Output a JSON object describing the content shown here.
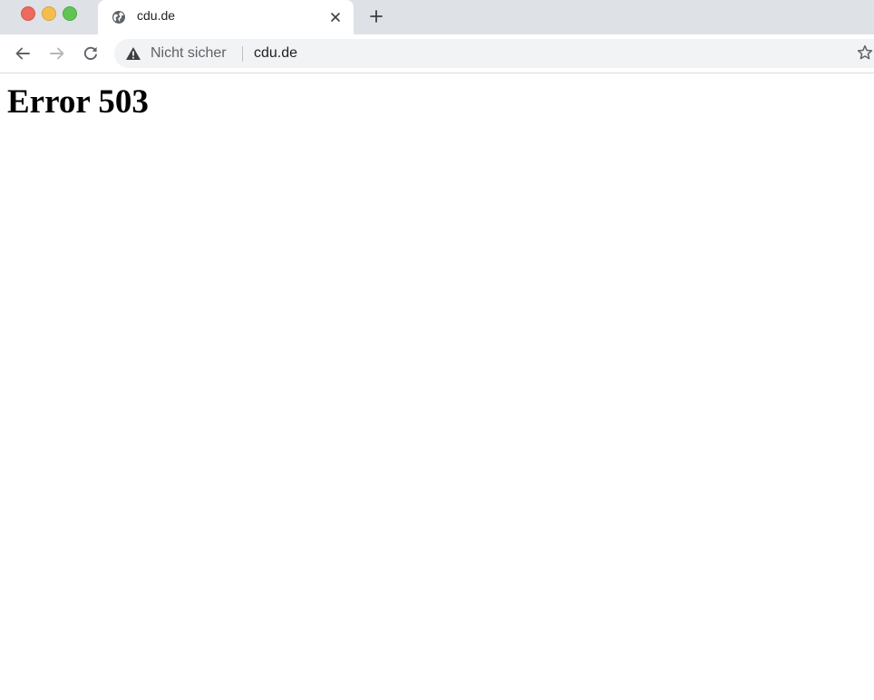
{
  "window": {
    "traffic_lights": [
      "close",
      "minimize",
      "maximize"
    ]
  },
  "tab": {
    "title": "cdu.de",
    "favicon": "globe-icon",
    "close_icon": "close-icon"
  },
  "new_tab_icon": "plus-icon",
  "toolbar": {
    "back_icon": "arrow-left-icon",
    "forward_icon": "arrow-right-icon",
    "reload_icon": "reload-icon",
    "security_icon": "warning-triangle-icon",
    "security_label": "Nicht sicher",
    "url": "cdu.de",
    "bookmark_icon": "star-icon"
  },
  "page": {
    "heading": "Error 503"
  },
  "colors": {
    "titlebar": "#dee1e6",
    "omnibox": "#f1f3f4",
    "close_light": "#ed6a5e",
    "minimize_light": "#f4be4f",
    "maximize_light": "#61c554"
  }
}
